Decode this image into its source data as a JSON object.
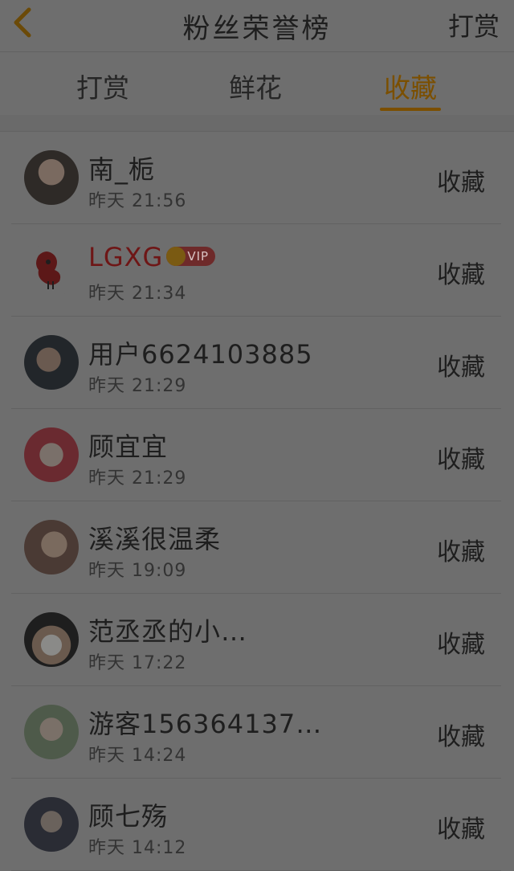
{
  "header": {
    "title": "粉丝荣誉榜",
    "action_label": "打赏"
  },
  "tabs": [
    {
      "label": "打赏"
    },
    {
      "label": "鲜花"
    },
    {
      "label": "收藏"
    }
  ],
  "active_tab": "收藏",
  "colors": {
    "accent": "#7b4f00",
    "vip": "#6e1616"
  },
  "list": [
    {
      "name": "南_栀",
      "time": "昨天 21:56",
      "action": "收藏"
    },
    {
      "name": "LGXG",
      "vip": "VIP",
      "time": "昨天 21:34",
      "action": "收藏"
    },
    {
      "name": "用户6624103885",
      "time": "昨天 21:29",
      "action": "收藏"
    },
    {
      "name": "顾宜宜",
      "time": "昨天 21:29",
      "action": "收藏"
    },
    {
      "name": "溪溪很温柔",
      "time": "昨天 19:09",
      "action": "收藏"
    },
    {
      "name": "范丞丞的小…",
      "time": "昨天 17:22",
      "action": "收藏"
    },
    {
      "name": "游客156364137…",
      "time": "昨天 14:24",
      "action": "收藏"
    },
    {
      "name": "顾七殇",
      "time": "昨天 14:12",
      "action": "收藏"
    }
  ]
}
